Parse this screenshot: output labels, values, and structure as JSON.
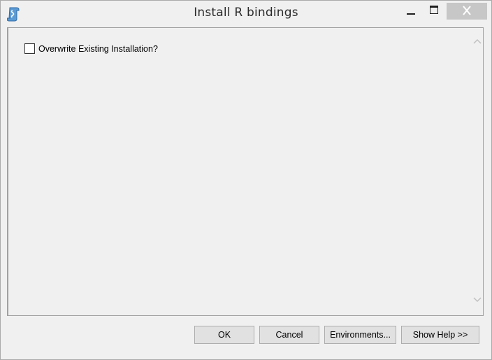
{
  "window": {
    "title": "Install R bindings"
  },
  "titlebar": {
    "app_icon": "script-scroll-icon",
    "minimize_icon": "minimize-icon",
    "maximize_icon": "maximize-icon",
    "close_icon": "close-icon"
  },
  "form": {
    "overwrite": {
      "label": "Overwrite Existing Installation?",
      "checked": false
    }
  },
  "scrollbar": {
    "up_icon": "chevron-up-icon",
    "down_icon": "chevron-down-icon"
  },
  "footer": {
    "ok_label": "OK",
    "cancel_label": "Cancel",
    "environments_label": "Environments...",
    "show_help_label": "Show Help >>"
  },
  "colors": {
    "window_bg": "#f0f0f0",
    "close_button_bg": "#c7c7c7",
    "button_bg": "#e1e1e1",
    "button_border": "#adadad"
  }
}
